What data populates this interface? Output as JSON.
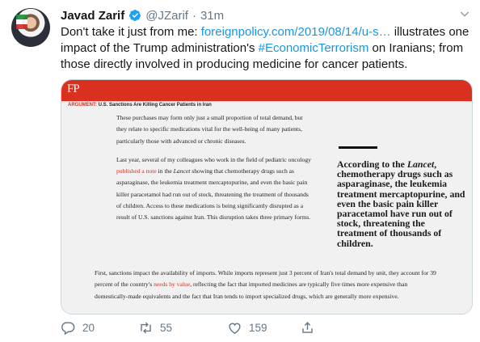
{
  "tweet": {
    "author_name": "Javad Zarif",
    "handle": "@JZarif",
    "separator": "·",
    "time": "31m",
    "text_prefix": "Don't take it just from me: ",
    "link": "foreignpolicy.com/2019/08/14/u-s…",
    "text_mid": " illustrates one impact of the Trump administration's ",
    "hashtag": "#EconomicTerrorism",
    "text_suffix": " on Iranians; from those directly involved in producing medicine for cancer patients."
  },
  "article": {
    "logo": "FP",
    "argument_label": "ARGUMENT:",
    "headline": " U.S. Sanctions Are Killing Cancer Patients in Iran",
    "para1": "These purchases may form only just a small proportion of total demand, but they relate to specific medications vital for the well-being of many patients, particularly those with advanced or chronic diseases.",
    "para2_a": "Last year, several of my colleagues who work in the field of pediatric oncology ",
    "para2_link": "published a note",
    "para2_b": " in the ",
    "para2_journal": "Lancet",
    "para2_c": " showing that chemotherapy drugs such as asparaginase, the leukemia treatment mercaptopurine, and even the basic pain killer paracetamol had run out of stock, threatening the treatment of thousands of children. Access to these medications is being significantly disrupted as a result of U.S. sanctions against Iran. This disruption takes three primary forms.",
    "pull_a": "According to the ",
    "pull_journal": "Lancet",
    "pull_b": ", chemotherapy drugs such as asparaginase, the leukemia treatment mercaptopurine, and even the basic pain killer paracetamol have run out of stock, threatening the treatment of thousands of children.",
    "para3_a": "First, sanctions impact the availability of imports. While imports represent just 3 percent of Iran's total demand by unit, they account for 39 percent of the country's ",
    "para3_link": "needs by value",
    "para3_b": ", reflecting the fact that imported medicines are typically five times more expensive than domestically-made equivalents and the fact that Iran tends to import specialized drugs, which are generally more expensive."
  },
  "actions": {
    "reply_count": "20",
    "retweet_count": "55",
    "like_count": "159",
    "icons": [
      "reply-icon",
      "retweet-icon",
      "like-icon",
      "share-icon"
    ]
  },
  "colors": {
    "link_blue": "#1b95e0",
    "fp_red": "#d9301f",
    "verified_blue": "#1da1f2",
    "muted": "#657786"
  }
}
